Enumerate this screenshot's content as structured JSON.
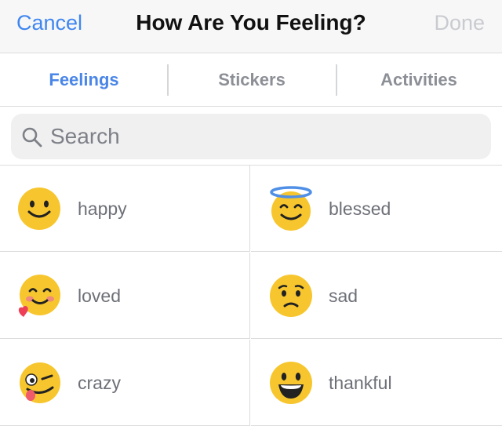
{
  "navbar": {
    "cancel_label": "Cancel",
    "title": "How Are You Feeling?",
    "done_label": "Done"
  },
  "tabs": [
    {
      "label": "Feelings",
      "active": true
    },
    {
      "label": "Stickers",
      "active": false
    },
    {
      "label": "Activities",
      "active": false
    }
  ],
  "search": {
    "placeholder": "Search",
    "icon": "search-icon"
  },
  "feelings": [
    {
      "label": "happy",
      "icon": "smiling-face-icon"
    },
    {
      "label": "blessed",
      "icon": "halo-face-icon"
    },
    {
      "label": "loved",
      "icon": "blushing-heart-face-icon"
    },
    {
      "label": "sad",
      "icon": "sad-face-icon"
    },
    {
      "label": "crazy",
      "icon": "winking-tongue-face-icon"
    },
    {
      "label": "thankful",
      "icon": "grinning-face-icon"
    }
  ],
  "colors": {
    "accent": "#4a86e8",
    "emoji_yellow": "#f7c62e",
    "disabled": "#c9cbd0"
  }
}
